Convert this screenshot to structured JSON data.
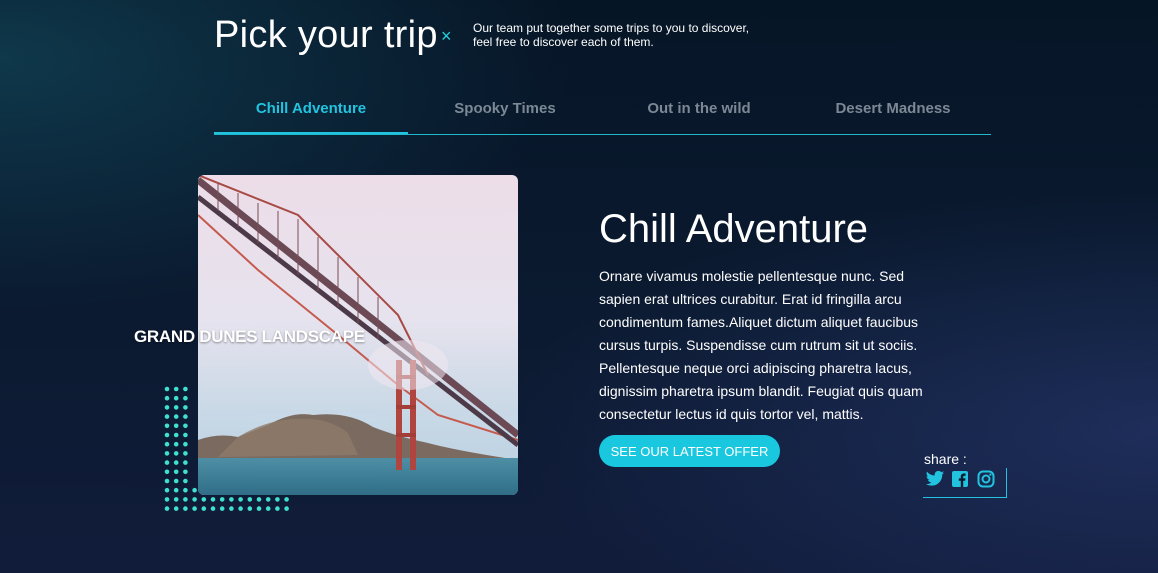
{
  "header": {
    "title": "Pick your trip",
    "close_glyph": "×",
    "intro_line1": "Our team put together some trips to you to discover,",
    "intro_line2": "feel free to discover each of them."
  },
  "tabs": [
    {
      "label": "Chill Adventure",
      "active": true
    },
    {
      "label": "Spooky Times",
      "active": false
    },
    {
      "label": "Out in the wild",
      "active": false
    },
    {
      "label": "Desert Madness",
      "active": false
    }
  ],
  "card": {
    "overlay_label": "GRAND DUNES LANDSCAPE",
    "heading": "Chill Adventure",
    "description": "Ornare vivamus molestie pellentesque nunc. Sed sapien erat ultrices curabitur. Erat id fringilla arcu condimentum fames.Aliquet dictum aliquet faucibus cursus turpis. Suspendisse cum rutrum sit ut sociis. Pellentesque neque orci adipiscing pharetra lacus, dignissim pharetra ipsum blandit. Feugiat quis quam consectetur lectus id quis tortor vel, mattis.",
    "cta_label": "SEE OUR LATEST OFFER"
  },
  "share": {
    "label": "share :",
    "icons": [
      "twitter-icon",
      "facebook-icon",
      "instagram-icon"
    ]
  },
  "colors": {
    "accent": "#22c3df",
    "button": "#19c7df",
    "inactive_tab": "#7c8894",
    "background": "#0b1a30"
  }
}
